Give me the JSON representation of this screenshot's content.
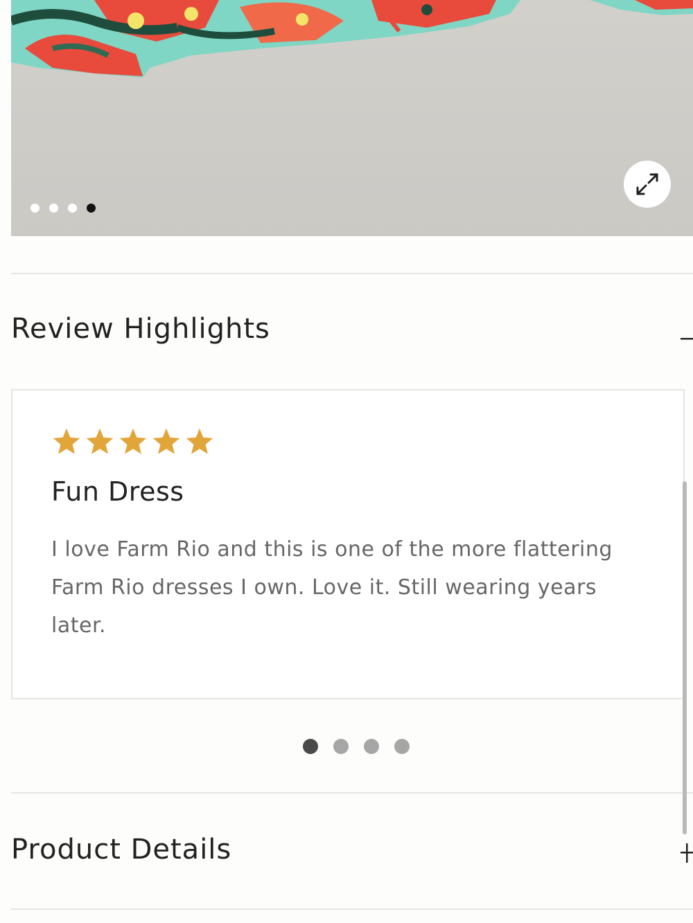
{
  "gallery": {
    "slide_count": 4,
    "active_slide": 4,
    "expand_icon": "expand-arrows-icon"
  },
  "review_highlights": {
    "title": "Review Highlights",
    "toggle_icon": "minus-icon",
    "review": {
      "rating": 5,
      "rating_max": 5,
      "title": "Fun Dress",
      "body": "I love Farm Rio and this is one of the more flattering Farm Rio dresses I own. Love it. Still wearing years later."
    },
    "pager": {
      "count": 4,
      "active": 1
    }
  },
  "product_details": {
    "title": "Product Details",
    "toggle_icon": "plus-icon"
  },
  "colors": {
    "star": "#e2a53a",
    "background": "#fdfdfb",
    "divider": "#e6e6e4"
  }
}
